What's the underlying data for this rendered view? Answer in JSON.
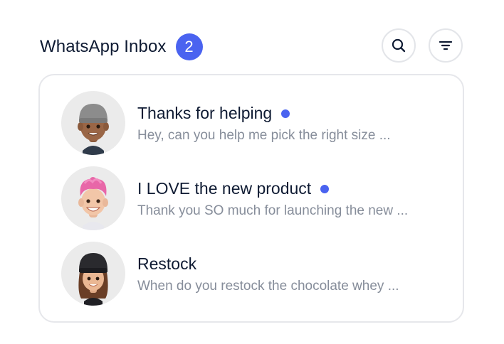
{
  "header": {
    "title": "WhatsApp Inbox",
    "unread_count": "2",
    "search_icon": "search-icon",
    "filter_icon": "filter-icon"
  },
  "colors": {
    "accent": "#4a63f0",
    "title_text": "#0f1b33",
    "preview_text": "#868d9a",
    "border": "#e6e7eb",
    "avatar_bg": "#ebebeb"
  },
  "conversations": [
    {
      "title": "Thanks for helping",
      "preview": "Hey, can you help me pick the right size ...",
      "unread": true,
      "avatar": "memoji-man-beanie"
    },
    {
      "title": "I LOVE the new product",
      "preview": "Thank you SO much for launching the new ...",
      "unread": true,
      "avatar": "memoji-pink-hair"
    },
    {
      "title": "Restock",
      "preview": "When do you restock the chocolate whey ...",
      "unread": false,
      "avatar": "memoji-woman-beanie"
    }
  ]
}
